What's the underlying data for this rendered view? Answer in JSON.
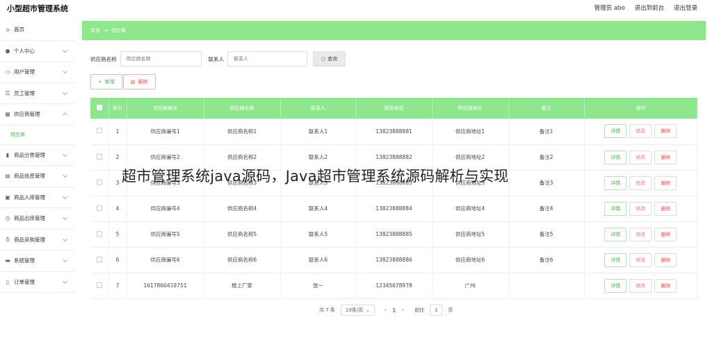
{
  "app": {
    "title": "小型超市管理系统"
  },
  "topnav": {
    "admin": "管理员 abo",
    "frontend": "退出到前台",
    "logout": "退出登录"
  },
  "sidebar": {
    "items": [
      {
        "label": "首页",
        "icon": "home-icon"
      },
      {
        "label": "个人中心",
        "icon": "user-icon"
      },
      {
        "label": "用户管理",
        "icon": "user-manage-icon"
      },
      {
        "label": "员工管理",
        "icon": "staff-icon"
      },
      {
        "label": "供应商管理",
        "icon": "supplier-icon"
      },
      {
        "label": "商品分类管理",
        "icon": "chart-icon"
      },
      {
        "label": "商品信息管理",
        "icon": "goods-icon"
      },
      {
        "label": "商品入库管理",
        "icon": "inbound-icon"
      },
      {
        "label": "商品出库管理",
        "icon": "outbound-icon"
      },
      {
        "label": "商品采购管理",
        "icon": "purchase-icon"
      },
      {
        "label": "系统管理",
        "icon": "system-icon"
      },
      {
        "label": "订单管理",
        "icon": "order-icon"
      }
    ],
    "active_sub": "供应商"
  },
  "breadcrumb": {
    "home": "首页",
    "arrow": "→",
    "current": "供应商"
  },
  "search": {
    "name_label": "供应商名称",
    "name_placeholder": "供应商名称",
    "contact_label": "联系人",
    "contact_placeholder": "联系人",
    "button": "查询"
  },
  "actions": {
    "add": "新增",
    "delete": "删除"
  },
  "table": {
    "headers": [
      "索引",
      "供应商编号",
      "供应商名称",
      "联系人",
      "联系电话",
      "供应商地址",
      "备注",
      "操作"
    ],
    "rows": [
      {
        "idx": "1",
        "code": "供应商编号1",
        "name": "供应商名称1",
        "contact": "联系人1",
        "phone": "13823888881",
        "addr": "供应商地址1",
        "note": "备注1"
      },
      {
        "idx": "2",
        "code": "供应商编号2",
        "name": "供应商名称2",
        "contact": "联系人2",
        "phone": "13823888882",
        "addr": "供应商地址2",
        "note": "备注2"
      },
      {
        "idx": "3",
        "code": "供应商编号3",
        "name": "供应商名称3",
        "contact": "联系人3",
        "phone": "13823888883",
        "addr": "供应商地址3",
        "note": "备注3"
      },
      {
        "idx": "4",
        "code": "供应商编号4",
        "name": "供应商名称4",
        "contact": "联系人4",
        "phone": "13823888884",
        "addr": "供应商地址4",
        "note": "备注4"
      },
      {
        "idx": "5",
        "code": "供应商编号5",
        "name": "供应商名称5",
        "contact": "联系人5",
        "phone": "13823888885",
        "addr": "供应商地址5",
        "note": "备注5"
      },
      {
        "idx": "6",
        "code": "供应商编号6",
        "name": "供应商名称6",
        "contact": "联系人6",
        "phone": "13823888886",
        "addr": "供应商地址6",
        "note": "备注6"
      },
      {
        "idx": "7",
        "code": "1617860419751",
        "name": "楼上厂家",
        "contact": "张一",
        "phone": "12345678978",
        "addr": "广州",
        "note": ""
      }
    ],
    "ops": {
      "detail": "详情",
      "edit": "修改",
      "delete": "删除"
    }
  },
  "pager": {
    "total": "共 7 条",
    "size": "10条/页",
    "current": "1",
    "goto_label": "前往",
    "goto_value": "1",
    "page_unit": "页"
  },
  "overlay_text": "超市管理系统java源码，Java超市管理系统源码解析与实现",
  "colors": {
    "accent": "#8ee68c",
    "green_text": "#4caf50",
    "danger": "#e05050"
  }
}
